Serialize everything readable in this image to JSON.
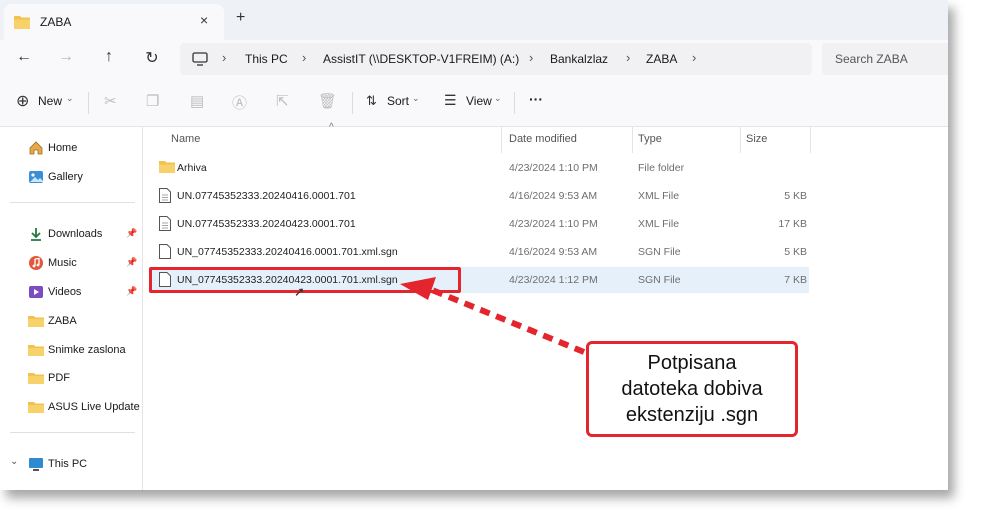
{
  "tab": {
    "title": "ZABA",
    "close": "×",
    "new": "+"
  },
  "nav": {
    "back": "←",
    "forward": "→",
    "up": "↑",
    "refresh": "↻"
  },
  "breadcrumb": [
    "This PC",
    "AssistIT (\\\\DESKTOP-V1FREIM) (A:)",
    "Bankalzlaz",
    "ZABA"
  ],
  "search": {
    "placeholder": "Search ZABA"
  },
  "toolbar": {
    "new_label": "New",
    "sort_label": "Sort",
    "view_label": "View",
    "more": "···"
  },
  "sidebar": {
    "items": [
      {
        "label": "Home",
        "icon": "home-icon"
      },
      {
        "label": "Gallery",
        "icon": "gallery-icon"
      },
      {
        "label": "Downloads",
        "icon": "downloads-icon",
        "pinned": true
      },
      {
        "label": "Music",
        "icon": "music-icon",
        "pinned": true
      },
      {
        "label": "Videos",
        "icon": "videos-icon",
        "pinned": true
      },
      {
        "label": "ZABA",
        "icon": "folder-icon"
      },
      {
        "label": "Snimke zaslona",
        "icon": "folder-icon"
      },
      {
        "label": "PDF",
        "icon": "folder-icon"
      },
      {
        "label": "ASUS Live Update",
        "icon": "folder-icon"
      },
      {
        "label": "This PC",
        "icon": "this-pc-icon"
      }
    ]
  },
  "columns": {
    "name": "Name",
    "date": "Date modified",
    "type": "Type",
    "size": "Size"
  },
  "files": [
    {
      "name": "Arhiva",
      "date": "4/23/2024 1:10 PM",
      "type": "File folder",
      "size": "",
      "kind": "folder"
    },
    {
      "name": "UN.07745352333.20240416.0001.701",
      "date": "4/16/2024 9:53 AM",
      "type": "XML File",
      "size": "5 KB",
      "kind": "file"
    },
    {
      "name": "UN.07745352333.20240423.0001.701",
      "date": "4/23/2024 1:10 PM",
      "type": "XML File",
      "size": "17 KB",
      "kind": "file"
    },
    {
      "name": "UN_07745352333.20240416.0001.701.xml.sgn",
      "date": "4/16/2024 9:53 AM",
      "type": "SGN File",
      "size": "5 KB",
      "kind": "file"
    },
    {
      "name": "UN_07745352333.20240423.0001.701.xml.sgn",
      "date": "4/23/2024 1:12 PM",
      "type": "SGN File",
      "size": "7 KB",
      "kind": "file",
      "selected": true
    }
  ],
  "callout": {
    "line1": "Potpisana",
    "line2": "datoteka dobiva",
    "line3": "ekstenziju .sgn"
  },
  "colors": {
    "accent": "#e3262d",
    "selection": "#e6f0fa",
    "folder": "#f2c24e"
  }
}
